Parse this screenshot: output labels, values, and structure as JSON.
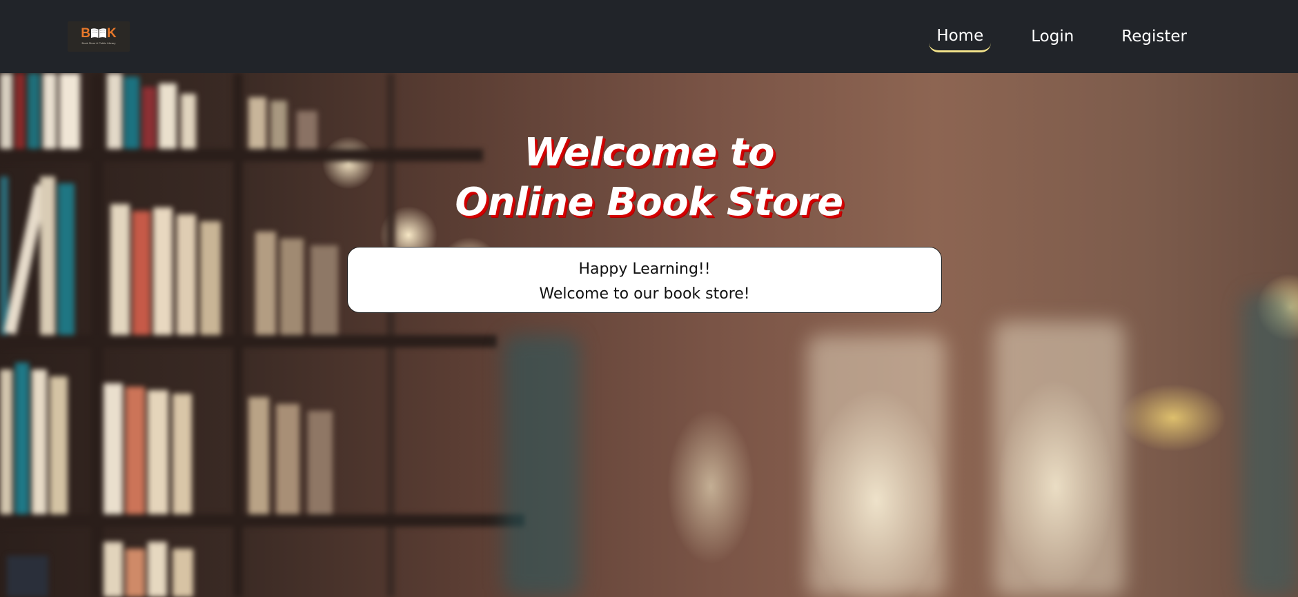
{
  "app": {
    "logo": {
      "prefix": "B",
      "suffix": "K",
      "tagline": "Book Store & Public Library"
    }
  },
  "nav": {
    "items": [
      {
        "label": "Home",
        "active": true
      },
      {
        "label": "Login",
        "active": false
      },
      {
        "label": "Register",
        "active": false
      }
    ],
    "active_underline_color": "#f2e28a",
    "background_color": "#212429"
  },
  "hero": {
    "title_line1": "Welcome to",
    "title_line2": "Online Book Store",
    "title_color": "#ffffff",
    "title_shadow_color": "#d40000",
    "message": {
      "line1": "Happy Learning!!",
      "line2": "Welcome to our book store!"
    }
  },
  "icons": {
    "logo_book": "open-book-icon"
  }
}
